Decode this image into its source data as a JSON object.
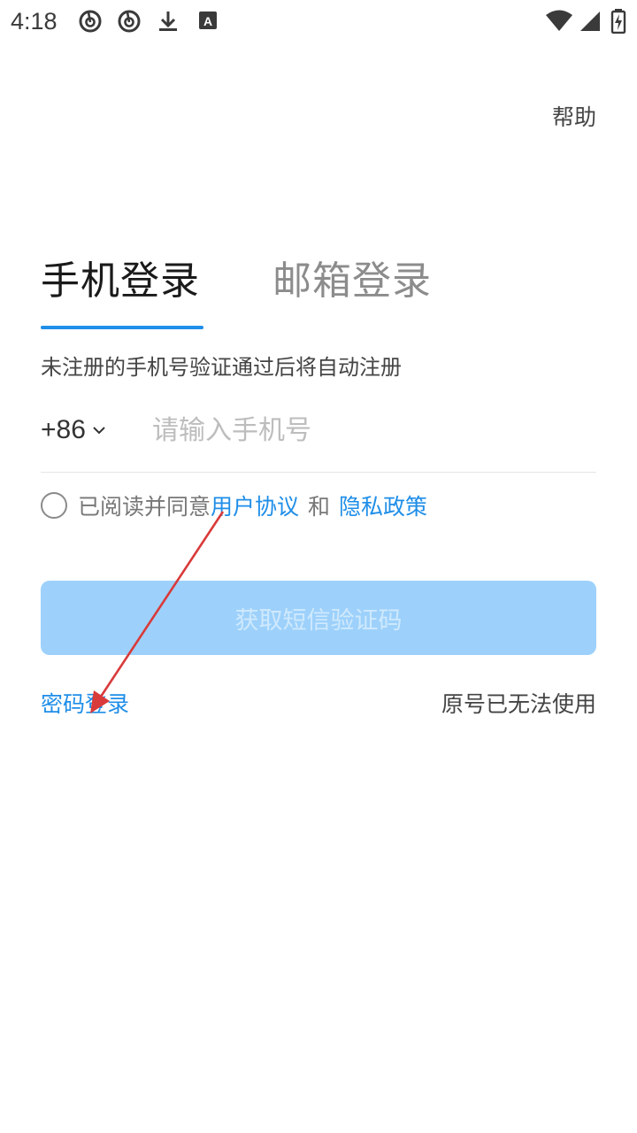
{
  "status_bar": {
    "time": "4:18",
    "icons": [
      "netease-music-icon",
      "netease-music-icon",
      "download-icon",
      "keyboard-a-icon",
      "wifi-icon",
      "signal-icon",
      "battery-charging-icon"
    ]
  },
  "header": {
    "help_label": "帮助"
  },
  "tabs": [
    {
      "label": "手机登录",
      "active": true
    },
    {
      "label": "邮箱登录",
      "active": false
    }
  ],
  "hint": "未注册的手机号验证通过后将自动注册",
  "phone": {
    "country_code": "+86",
    "placeholder": "请输入手机号",
    "value": ""
  },
  "agreement": {
    "checked": false,
    "prefix": "已阅读并同意",
    "user_agreement": "用户协议",
    "and": "和",
    "privacy_policy": "隐私政策"
  },
  "actions": {
    "get_sms_code": "获取短信验证码",
    "password_login": "密码登录",
    "number_unavailable": "原号已无法使用"
  },
  "colors": {
    "accent": "#1f8ee8",
    "button_disabled_bg": "#9dd1fb",
    "button_disabled_text": "#cfe9fd",
    "annotation_arrow": "#d93a3a"
  }
}
